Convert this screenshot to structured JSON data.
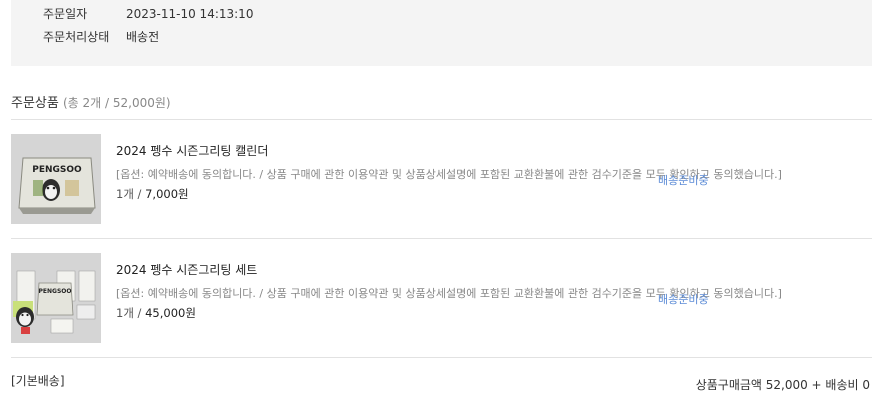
{
  "order_info": {
    "date_label": "주문일자",
    "date_value": "2023-11-10 14:13:10",
    "status_label": "주문처리상태",
    "status_value": "배송전"
  },
  "products_section": {
    "title": "주문상품",
    "summary": "(총 2개 / 52,000원)"
  },
  "products": [
    {
      "name": "2024 펭수 시즌그리팅 캘린더",
      "option": "[옵션: 예약배송에 동의합니다. / 상품 구매에 관한 이용약관 및 상품상세설명에 포함된 교환환불에 관한 검수기준을 모두 확인하고 동의했습니다.]",
      "quantity": "1개",
      "price": "7,000원",
      "status": "배송준비중",
      "thumb_text": "PENGSOO"
    },
    {
      "name": "2024 펭수 시즌그리팅 세트",
      "option": "[옵션: 예약배송에 동의합니다. / 상품 구매에 관한 이용약관 및 상품상세설명에 포함된 교환환불에 관한 검수기준을 모두 확인하고 동의했습니다.]",
      "quantity": "1개",
      "price": "45,000원",
      "status": "배송준비중",
      "thumb_text": "PENGSOO"
    }
  ],
  "shipping": {
    "label": "[기본배송]",
    "total": "상품구매금액 52,000 + 배송비 0"
  },
  "colors": {
    "info_bg": "#f4f4f4",
    "status_blue": "#5b8bd6",
    "divider": "#e2e2e2"
  }
}
